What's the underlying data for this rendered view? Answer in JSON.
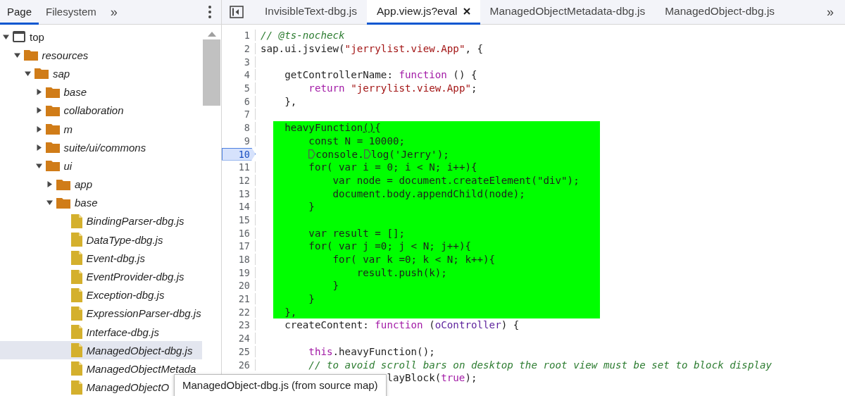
{
  "navigator": {
    "tabs": [
      {
        "label": "Page",
        "selected": true
      },
      {
        "label": "Filesystem",
        "selected": false
      }
    ],
    "more": "»",
    "tree": [
      {
        "label": "top",
        "kind": "frame",
        "expanded": true,
        "selected": false,
        "children": [
          {
            "label": "resources",
            "kind": "folder",
            "expanded": true,
            "selected": false,
            "children": [
              {
                "label": "sap",
                "kind": "folder",
                "expanded": true,
                "selected": false,
                "children": [
                  {
                    "label": "base",
                    "kind": "folder",
                    "expanded": false,
                    "selected": false
                  },
                  {
                    "label": "collaboration",
                    "kind": "folder",
                    "expanded": false,
                    "selected": false
                  },
                  {
                    "label": "m",
                    "kind": "folder",
                    "expanded": false,
                    "selected": false
                  },
                  {
                    "label": "suite/ui/commons",
                    "kind": "folder",
                    "expanded": false,
                    "selected": false
                  },
                  {
                    "label": "ui",
                    "kind": "folder",
                    "expanded": true,
                    "selected": false,
                    "children": [
                      {
                        "label": "app",
                        "kind": "folder",
                        "expanded": false,
                        "selected": false
                      },
                      {
                        "label": "base",
                        "kind": "folder",
                        "expanded": true,
                        "selected": false,
                        "children": [
                          {
                            "label": "BindingParser-dbg.js",
                            "kind": "file",
                            "selected": false
                          },
                          {
                            "label": "DataType-dbg.js",
                            "kind": "file",
                            "selected": false
                          },
                          {
                            "label": "Event-dbg.js",
                            "kind": "file",
                            "selected": false
                          },
                          {
                            "label": "EventProvider-dbg.js",
                            "kind": "file",
                            "selected": false
                          },
                          {
                            "label": "Exception-dbg.js",
                            "kind": "file",
                            "selected": false
                          },
                          {
                            "label": "ExpressionParser-dbg.js",
                            "kind": "file",
                            "selected": false
                          },
                          {
                            "label": "Interface-dbg.js",
                            "kind": "file",
                            "selected": false
                          },
                          {
                            "label": "ManagedObject-dbg.js",
                            "kind": "file",
                            "selected": true
                          },
                          {
                            "label": "ManagedObjectMetada",
                            "kind": "file",
                            "selected": false
                          },
                          {
                            "label": "ManagedObjectO",
                            "kind": "file",
                            "selected": false
                          }
                        ]
                      }
                    ]
                  }
                ]
              }
            ]
          }
        ]
      }
    ]
  },
  "editor": {
    "tabs": [
      {
        "label": "InvisibleText-dbg.js",
        "selected": false,
        "closable": false
      },
      {
        "label": "App.view.js?eval",
        "selected": true,
        "closable": true
      },
      {
        "label": "ManagedObjectMetadata-dbg.js",
        "selected": false,
        "closable": false
      },
      {
        "label": "ManagedObject-dbg.js",
        "selected": false,
        "closable": false
      }
    ],
    "more": "»",
    "lines": [
      {
        "n": "1",
        "highlighted": false,
        "breakpoint": false,
        "tokens": [
          {
            "text": "// @ts-nocheck",
            "kind": "comment"
          }
        ]
      },
      {
        "n": "2",
        "highlighted": false,
        "breakpoint": false,
        "tokens": [
          {
            "text": "sap.ui.jsview(",
            "kind": "plain"
          },
          {
            "text": "\"jerrylist.view.App\"",
            "kind": "string"
          },
          {
            "text": ", {",
            "kind": "plain"
          }
        ]
      },
      {
        "n": "3",
        "highlighted": false,
        "breakpoint": false
      },
      {
        "n": "4",
        "highlighted": false,
        "breakpoint": false,
        "tokens": [
          {
            "text": "    getControllerName: ",
            "kind": "plain"
          },
          {
            "text": "function",
            "kind": "keyword"
          },
          {
            "text": " () {",
            "kind": "plain"
          }
        ]
      },
      {
        "n": "5",
        "highlighted": false,
        "breakpoint": false,
        "tokens": [
          {
            "text": "        return",
            "kind": "keyword"
          },
          {
            "text": " \"jerrylist.view.App\"",
            "kind": "string"
          },
          {
            "text": ";",
            "kind": "plain"
          }
        ]
      },
      {
        "n": "6",
        "highlighted": false,
        "breakpoint": false,
        "tokens": [
          {
            "text": "    },",
            "kind": "plain"
          }
        ]
      },
      {
        "n": "7",
        "highlighted": false,
        "breakpoint": false
      },
      {
        "n": "8",
        "highlighted": true,
        "breakpoint": false,
        "tokens": [
          {
            "text": "    heavyFunction",
            "kind": "plain"
          },
          {
            "text": "()",
            "kind": "match"
          },
          {
            "text": "{",
            "kind": "plain"
          }
        ]
      },
      {
        "n": "9",
        "highlighted": true,
        "breakpoint": false,
        "tokens": [
          {
            "text": "        const N = 10000;",
            "kind": "plain"
          }
        ]
      },
      {
        "n": "10",
        "highlighted": true,
        "breakpoint": true,
        "tokens": [
          {
            "text": "        console.",
            "kind": "plain",
            "inline_breakpoint": true
          },
          {
            "text": "log('Jerry');",
            "kind": "plain",
            "inline_breakpoint": true
          }
        ]
      },
      {
        "n": "11",
        "highlighted": true,
        "breakpoint": false,
        "tokens": [
          {
            "text": "        for( var i = 0; i < N; i++){",
            "kind": "plain"
          }
        ]
      },
      {
        "n": "12",
        "highlighted": true,
        "breakpoint": false,
        "tokens": [
          {
            "text": "            var node = document.createElement(\"div\");",
            "kind": "plain"
          }
        ]
      },
      {
        "n": "13",
        "highlighted": true,
        "breakpoint": false,
        "tokens": [
          {
            "text": "            document.body.appendChild(node);",
            "kind": "plain"
          }
        ]
      },
      {
        "n": "14",
        "highlighted": true,
        "breakpoint": false,
        "tokens": [
          {
            "text": "        }",
            "kind": "plain"
          }
        ]
      },
      {
        "n": "15",
        "highlighted": true,
        "breakpoint": false
      },
      {
        "n": "16",
        "highlighted": true,
        "breakpoint": false,
        "tokens": [
          {
            "text": "        var result = [];",
            "kind": "plain"
          }
        ]
      },
      {
        "n": "17",
        "highlighted": true,
        "breakpoint": false,
        "tokens": [
          {
            "text": "        for( var j =0; j < N; j++){",
            "kind": "plain"
          }
        ]
      },
      {
        "n": "18",
        "highlighted": true,
        "breakpoint": false,
        "tokens": [
          {
            "text": "            for( var k =0; k < N; k++){",
            "kind": "plain"
          }
        ]
      },
      {
        "n": "19",
        "highlighted": true,
        "breakpoint": false,
        "tokens": [
          {
            "text": "                result.push(k);",
            "kind": "plain"
          }
        ]
      },
      {
        "n": "20",
        "highlighted": true,
        "breakpoint": false,
        "tokens": [
          {
            "text": "            }",
            "kind": "plain"
          }
        ]
      },
      {
        "n": "21",
        "highlighted": true,
        "breakpoint": false,
        "tokens": [
          {
            "text": "        }",
            "kind": "plain"
          }
        ]
      },
      {
        "n": "22",
        "highlighted": true,
        "breakpoint": false,
        "tokens": [
          {
            "text": "    },",
            "kind": "plain"
          }
        ]
      },
      {
        "n": "23",
        "highlighted": false,
        "breakpoint": false,
        "tokens": [
          {
            "text": "    createContent: ",
            "kind": "plain"
          },
          {
            "text": "function",
            "kind": "keyword"
          },
          {
            "text": " (",
            "kind": "plain"
          },
          {
            "text": "oController",
            "kind": "param"
          },
          {
            "text": ") {",
            "kind": "plain"
          }
        ]
      },
      {
        "n": "24",
        "highlighted": false,
        "breakpoint": false
      },
      {
        "n": "25",
        "highlighted": false,
        "breakpoint": false,
        "tokens": [
          {
            "text": "        this",
            "kind": "keyword"
          },
          {
            "text": ".heavyFunction();",
            "kind": "plain"
          }
        ]
      },
      {
        "n": "26",
        "highlighted": false,
        "breakpoint": false,
        "tokens": [
          {
            "text": "        // to avoid scroll bars on desktop the root view must be set to block display",
            "kind": "comment"
          }
        ]
      },
      {
        "highlighted": false,
        "tokens": [
          {
            "text": "                     layBlock(",
            "kind": "plain"
          },
          {
            "text": "true",
            "kind": "keyword"
          },
          {
            "text": ");",
            "kind": "plain"
          }
        ]
      }
    ]
  },
  "tooltip": "ManagedObject-dbg.js (from source map)"
}
